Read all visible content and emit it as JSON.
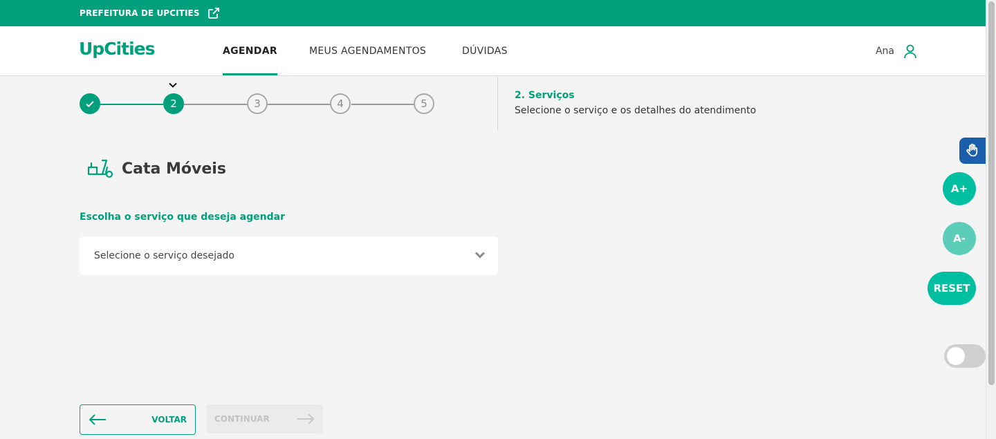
{
  "header": {
    "city_link": "PREFEITURA DE UPCITIES",
    "logo": "UpCities",
    "nav": [
      {
        "label": "AGENDAR",
        "active": true
      },
      {
        "label": "MEUS AGENDAMENTOS",
        "active": false
      },
      {
        "label": "DÚVIDAS",
        "active": false
      }
    ],
    "user_name": "Ana",
    "user_icon": "user-icon",
    "external_icon": "external-link-icon"
  },
  "stepper": {
    "steps": [
      {
        "label": "",
        "state": "done"
      },
      {
        "label": "2",
        "state": "current"
      },
      {
        "label": "3",
        "state": "pending"
      },
      {
        "label": "4",
        "state": "pending"
      },
      {
        "label": "5",
        "state": "pending"
      }
    ],
    "current_title": "2. Serviços",
    "current_description": "Selecione o serviço e os detalhes do atendimento"
  },
  "service": {
    "title": "Cata Móveis",
    "icon": "furniture-truck-icon"
  },
  "form": {
    "label": "Escolha o serviço que deseja agendar",
    "select_placeholder": "Selecione o serviço desejado"
  },
  "actions": {
    "back": "VOLTAR",
    "continue": "CONTINUAR",
    "continue_disabled": true
  },
  "accessibility": {
    "vlibras_icon": "sign-language-icon",
    "increase_font": "A+",
    "decrease_font": "A-",
    "reset": "RESET",
    "contrast_toggle_on": false
  },
  "colors": {
    "brand": "#00a07c",
    "accent": "#00bfa0",
    "vlibras": "#1b5fac"
  }
}
